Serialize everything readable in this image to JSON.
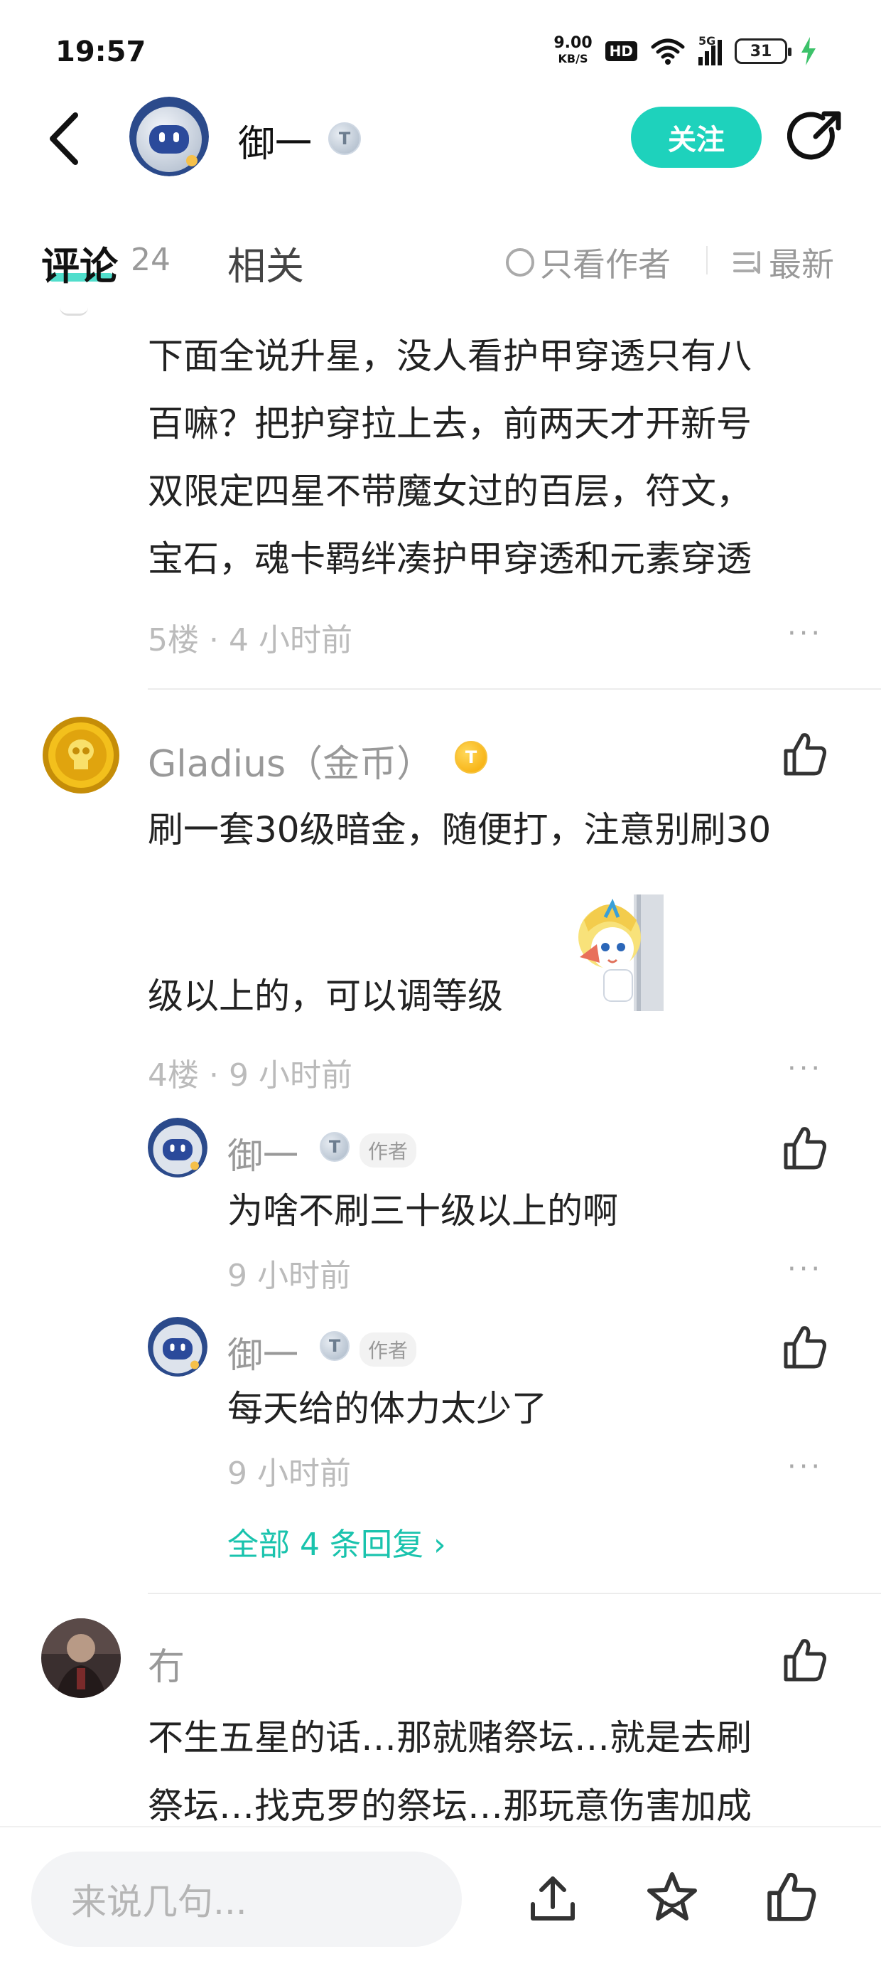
{
  "status_bar": {
    "time": "19:57",
    "net_speed_value": "9.00",
    "net_speed_unit": "KB/S",
    "hd": "HD",
    "signal": "5G",
    "battery": "31"
  },
  "header": {
    "username": "御一",
    "level_badge": "T",
    "follow_label": "关注"
  },
  "tabs": {
    "comments_label": "评论",
    "comments_count": "24",
    "related_label": "相关",
    "author_only_label": "只看作者",
    "sort_label": "最新"
  },
  "comment_5": {
    "lines": [
      "下面全说升星，没人看护甲穿透只有八",
      "百嘛？把护穿拉上去，前两天才开新号",
      "双限定四星不带魔女过的百层，符文，",
      "宝石，魂卡羁绊凑护甲穿透和元素穿透"
    ],
    "floor": "5楼",
    "time": "4 小时前",
    "more": "···"
  },
  "comment_4": {
    "username": "Gladius（金币）",
    "level_badge": "T",
    "line1": "刷一套30级暗金，随便打，注意别刷30",
    "line2": "级以上的，可以调等级",
    "floor": "4楼",
    "time": "9 小时前",
    "more": "···",
    "replies": [
      {
        "username": "御一",
        "level_badge": "T",
        "tag": "作者",
        "text": "为啥不刷三十级以上的啊",
        "time": "9 小时前",
        "more": "···"
      },
      {
        "username": "御一",
        "level_badge": "T",
        "tag": "作者",
        "text": "每天给的体力太少了",
        "time": "9 小时前",
        "more": "···"
      }
    ],
    "all_replies": "全部 4 条回复 ›"
  },
  "comment_3": {
    "username": "冇",
    "line1": "不生五星的话…那就赌祭坛…就是去刷",
    "line2": "祭坛…找克罗的祭坛…那玩意伤害加成"
  },
  "bottom_bar": {
    "input_placeholder": "来说几句..."
  },
  "colors": {
    "accent": "#1ed2bc",
    "link": "#19c3ad",
    "muted": "#999999"
  },
  "icons": [
    "back-arrow-icon",
    "share-icon",
    "radio-circle-icon",
    "sort-icon",
    "thumbs-up-icon",
    "upload-icon",
    "star-icon",
    "more-dots-icon"
  ]
}
